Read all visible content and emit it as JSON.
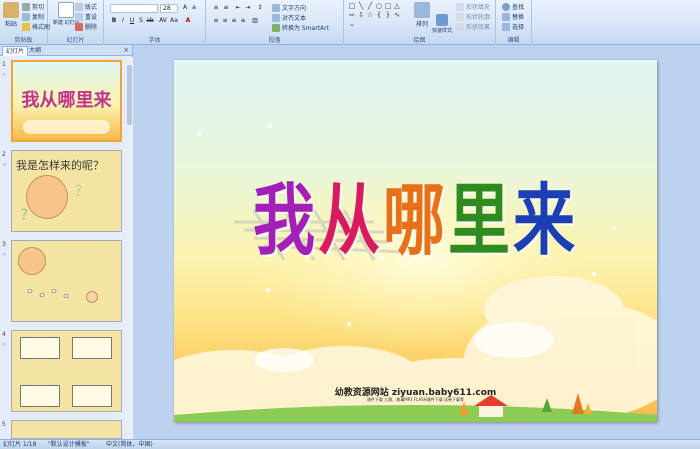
{
  "ribbon": {
    "clipboard": {
      "label": "剪贴板",
      "paste": "粘贴",
      "cut": "剪切",
      "copy": "复制",
      "format_painter": "格式刷"
    },
    "slides": {
      "label": "幻灯片",
      "new_slide": "新建\n幻灯片",
      "layout": "版式",
      "reset": "重设",
      "delete": "删除"
    },
    "font": {
      "label": "字体",
      "font_name": "",
      "font_size": "28"
    },
    "paragraph": {
      "label": "段落",
      "text_direction": "文字方向",
      "align_text": "对齐文本",
      "smartart": "转换为 SmartArt"
    },
    "drawing": {
      "label": "绘图",
      "arrange": "排列",
      "quick_styles": "快速样式",
      "shape_fill": "形状填充",
      "shape_outline": "形状轮廓",
      "shape_effects": "形状效果"
    },
    "editing": {
      "label": "编辑",
      "find": "查找",
      "replace": "替换",
      "select": "选择"
    }
  },
  "panel": {
    "tab_slides": "幻灯片",
    "tab_outline": "大纲",
    "thumbnails": [
      {
        "num": "1",
        "title": "我从哪里来"
      },
      {
        "num": "2",
        "title": "我是怎样来的呢？"
      },
      {
        "num": "3",
        "title": ""
      },
      {
        "num": "4",
        "title": ""
      },
      {
        "num": "5",
        "title": ""
      }
    ]
  },
  "slide": {
    "title_chars": [
      "我",
      "从",
      "哪",
      "里",
      "来"
    ],
    "title_colors": [
      "#a21fb8",
      "#d81b60",
      "#e8701a",
      "#2e8b1f",
      "#1c3fb5"
    ],
    "site": "幼教资源网站  ziyuan.baby611.com",
    "subline": "课件下载  儿歌、故事MP3  FLASH课件下载  试卷下载等"
  },
  "status": {
    "slide_count": "幻灯片 1/18",
    "theme": "\"默认设计模板\"",
    "language": "中文(简体，中国)"
  }
}
